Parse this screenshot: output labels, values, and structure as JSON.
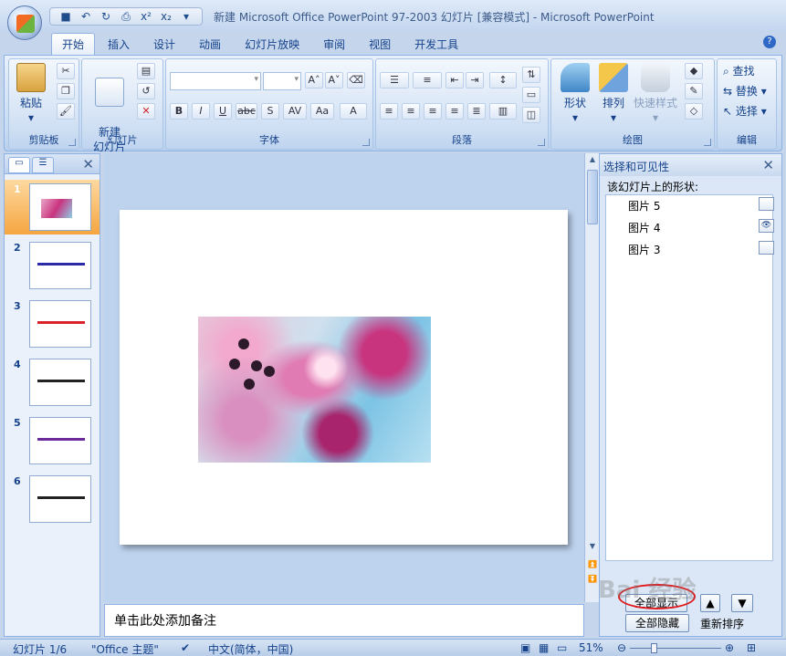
{
  "window_title": "新建 Microsoft Office PowerPoint 97-2003 幻灯片 [兼容模式] - Microsoft PowerPoint",
  "quick_access": [
    "save-icon",
    "undo-icon",
    "redo-icon",
    "print-preview-icon",
    "superscript-icon",
    "subscript-icon"
  ],
  "quick_access_labels": [
    "x²",
    "x₂"
  ],
  "tabs": [
    "开始",
    "插入",
    "设计",
    "动画",
    "幻灯片放映",
    "审阅",
    "视图",
    "开发工具"
  ],
  "ribbon": {
    "clipboard": {
      "label": "剪贴板",
      "paste": "粘贴"
    },
    "slides": {
      "label": "幻灯片",
      "new_slide": "新建\n幻灯片"
    },
    "font": {
      "label": "字体",
      "buttons": [
        "B",
        "I",
        "U",
        "abc",
        "S",
        "AV",
        "Aa",
        "A"
      ]
    },
    "paragraph": {
      "label": "段落"
    },
    "drawing": {
      "label": "绘图",
      "shapes": "形状",
      "arrange": "排列",
      "quick_styles": "快速样式"
    },
    "editing": {
      "label": "编辑",
      "find": "查找",
      "replace": "替换",
      "select": "选择"
    }
  },
  "slide_pane": {
    "slides": [
      {
        "num": "1",
        "selected": true
      },
      {
        "num": "2",
        "color": "#2a2aa8"
      },
      {
        "num": "3",
        "color": "#d8232a"
      },
      {
        "num": "4",
        "color": "#222222"
      },
      {
        "num": "5",
        "color": "#6a2a9a"
      },
      {
        "num": "6",
        "color": "#222222"
      }
    ]
  },
  "notes_placeholder": "单击此处添加备注",
  "selection_pane": {
    "title": "选择和可见性",
    "subtitle": "该幻灯片上的形状:",
    "shapes": [
      {
        "name": "图片 5",
        "visible": false
      },
      {
        "name": "图片 4",
        "visible": true
      },
      {
        "name": "图片 3",
        "visible": false
      }
    ],
    "show_all": "全部显示",
    "hide_all": "全部隐藏",
    "reorder": "重新排序"
  },
  "status": {
    "slide_info": "幻灯片 1/6",
    "theme": "\"Office 主题\"",
    "language": "中文(简体，中国)",
    "zoom": "51%"
  },
  "colors": {
    "accent": "#15428b",
    "selected_thumb": "#f5a540",
    "highlight_ring": "#e0191c"
  }
}
